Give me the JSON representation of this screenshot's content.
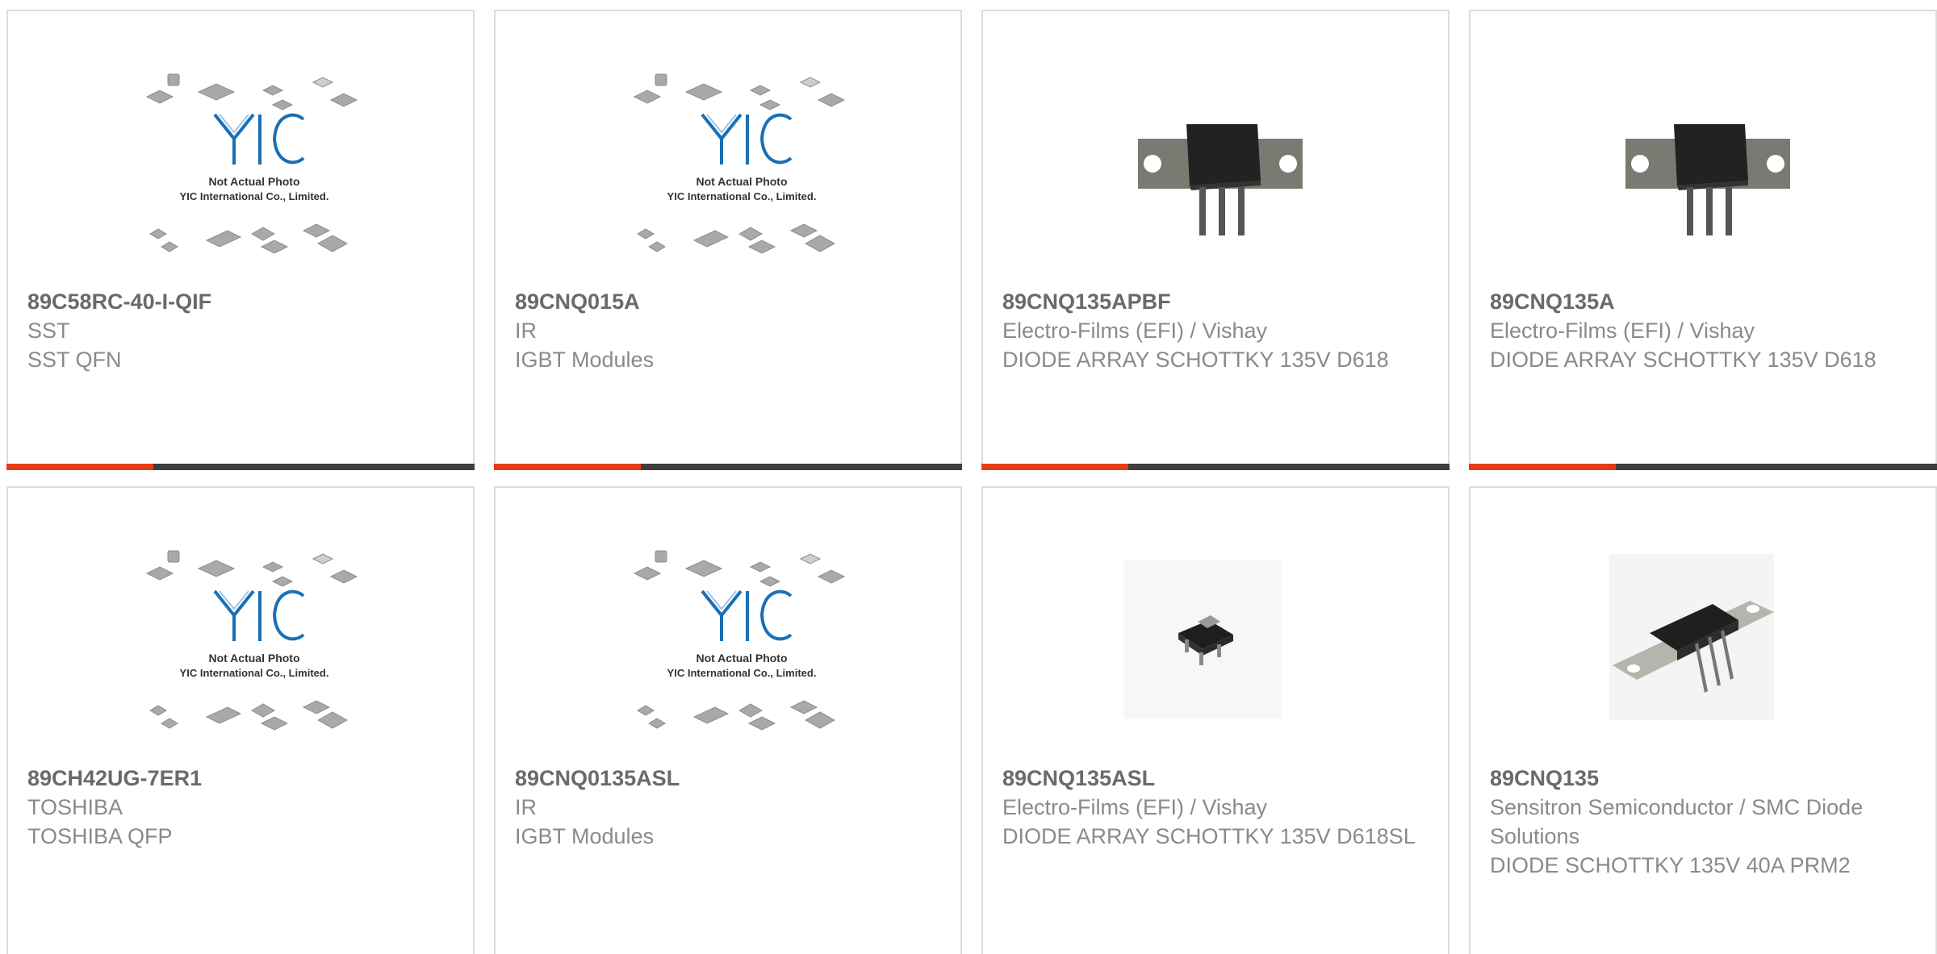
{
  "products": [
    {
      "part": "89C58RC-40-I-QIF",
      "maker": "SST",
      "desc": "SST QFN",
      "image": "placeholder-image"
    },
    {
      "part": "89CNQ015A",
      "maker": "IR",
      "desc": "IGBT Modules",
      "image": "placeholder-image"
    },
    {
      "part": "89CNQ135APBF",
      "maker": "Electro-Films (EFI) / Vishay",
      "desc": "DIODE ARRAY SCHOTTKY 135V D618",
      "image": "d618-package"
    },
    {
      "part": "89CNQ135A",
      "maker": "Electro-Films (EFI) / Vishay",
      "desc": "DIODE ARRAY SCHOTTKY 135V D618",
      "image": "d618-package"
    },
    {
      "part": "89CH42UG-7ER1",
      "maker": "TOSHIBA",
      "desc": "TOSHIBA QFP",
      "image": "placeholder-image"
    },
    {
      "part": "89CNQ0135ASL",
      "maker": "IR",
      "desc": "IGBT Modules",
      "image": "placeholder-image"
    },
    {
      "part": "89CNQ135ASL",
      "maker": "Electro-Films (EFI) / Vishay",
      "desc": "DIODE ARRAY SCHOTTKY 135V D618SL",
      "image": "sot-package"
    },
    {
      "part": "89CNQ135",
      "maker": "Sensitron Semiconductor / SMC Diode Solutions",
      "desc": "DIODE SCHOTTKY 135V 40A PRM2",
      "image": "prm2-package"
    }
  ],
  "placeholder": {
    "line1": "Not Actual Photo",
    "line2": "YIC International Co., Limited.",
    "logo": "YIC"
  },
  "colors": {
    "accent": "#e63a14",
    "bar": "#3e3e3e",
    "border": "#dcdcdc",
    "logo": "#1a6fb5"
  }
}
